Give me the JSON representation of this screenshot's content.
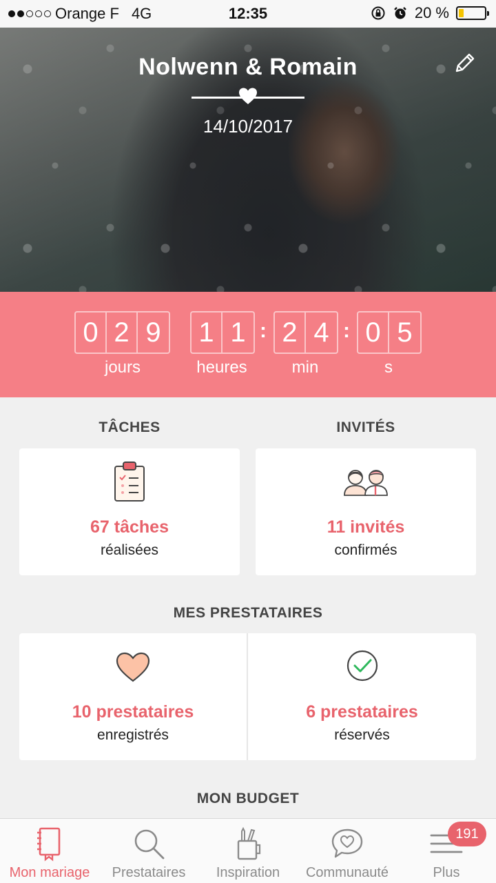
{
  "status_bar": {
    "carrier": "Orange F",
    "network": "4G",
    "time": "12:35",
    "battery_percent": "20 %",
    "battery_level": 0.2
  },
  "hero": {
    "couple_name": "Nolwenn & Romain",
    "wedding_date": "14/10/2017"
  },
  "countdown": {
    "days": [
      "0",
      "2",
      "9"
    ],
    "hours": [
      "1",
      "1"
    ],
    "minutes": [
      "2",
      "4"
    ],
    "seconds": [
      "0",
      "5"
    ],
    "days_label": "jours",
    "hours_label": "heures",
    "minutes_label": "min",
    "seconds_label": "s",
    "background_color": "#f57f86"
  },
  "tasks": {
    "title": "TÂCHES",
    "value": "67 tâches",
    "sub": "réalisées"
  },
  "guests": {
    "title": "INVITÉS",
    "value": "11 invités",
    "sub": "confirmés"
  },
  "vendors": {
    "title": "MES PRESTATAIRES",
    "saved_value": "10 prestataires",
    "saved_sub": "enregistrés",
    "booked_value": "6 prestataires",
    "booked_sub": "réservés"
  },
  "budget": {
    "title": "MON BUDGET"
  },
  "tabbar": {
    "items": [
      {
        "label": "Mon mariage",
        "icon": "notebook-icon",
        "active": true
      },
      {
        "label": "Prestataires",
        "icon": "search-icon",
        "active": false
      },
      {
        "label": "Inspiration",
        "icon": "pencil-cup-icon",
        "active": false
      },
      {
        "label": "Communauté",
        "icon": "chat-heart-icon",
        "active": false
      },
      {
        "label": "Plus",
        "icon": "menu-icon",
        "active": false
      }
    ],
    "badge": "191"
  },
  "colors": {
    "accent": "#e8636c",
    "background": "#f0f0f0"
  }
}
